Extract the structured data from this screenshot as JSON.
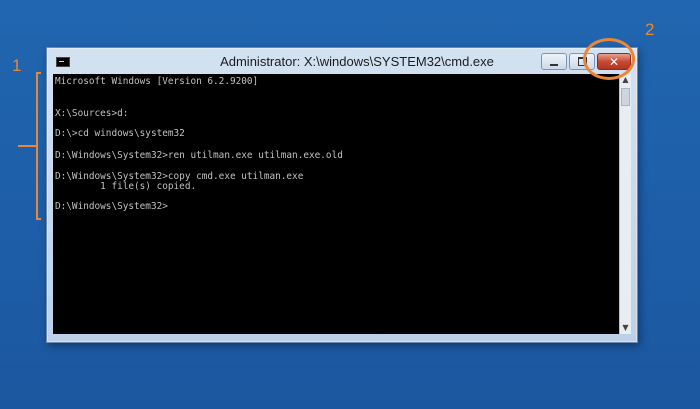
{
  "window": {
    "title": "Administrator: X:\\windows\\SYSTEM32\\cmd.exe",
    "controls": {
      "minimize": "",
      "maximize": "",
      "close": "✕"
    }
  },
  "console": {
    "lines": [
      "Microsoft Windows [Version 6.2.9200]",
      "X:\\Sources>d:",
      "D:\\>cd windows\\system32",
      "D:\\Windows\\System32>ren utilman.exe utilman.exe.old",
      "D:\\Windows\\System32>copy cmd.exe utilman.exe",
      "        1 file(s) copied.",
      "D:\\Windows\\System32>"
    ]
  },
  "annotations": {
    "label_1": "1",
    "label_2": "2",
    "color": "#e8863a"
  },
  "icons": {
    "app": "console-icon",
    "scroll_up": "▲",
    "scroll_down": "▼"
  }
}
